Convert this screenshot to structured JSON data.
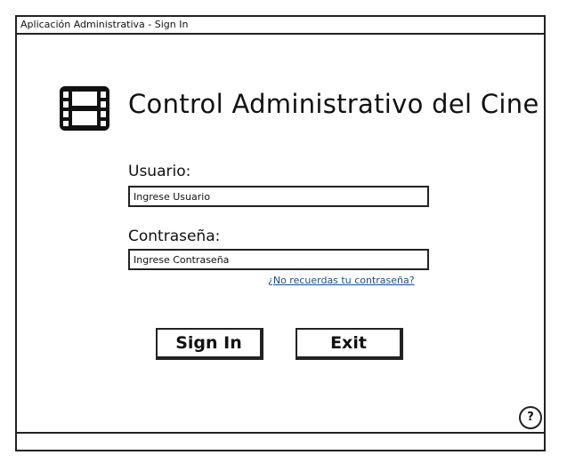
{
  "window": {
    "title": "Aplicación Administrativa - Sign In"
  },
  "header": {
    "icon": "film-icon",
    "app_title": "Control Administrativo del Cine"
  },
  "form": {
    "username": {
      "label": "Usuario:",
      "placeholder": "Ingrese Usuario",
      "value": ""
    },
    "password": {
      "label": "Contraseña:",
      "placeholder": "Ingrese Contraseña",
      "value": ""
    },
    "forgot_password": "¿No recuerdas tu contraseña?"
  },
  "actions": {
    "signin_label": "Sign In",
    "exit_label": "Exit"
  },
  "help": {
    "icon": "help-icon",
    "label": "?"
  },
  "colors": {
    "border": "#222222",
    "link": "#1a4e8a",
    "background": "#ffffff"
  }
}
